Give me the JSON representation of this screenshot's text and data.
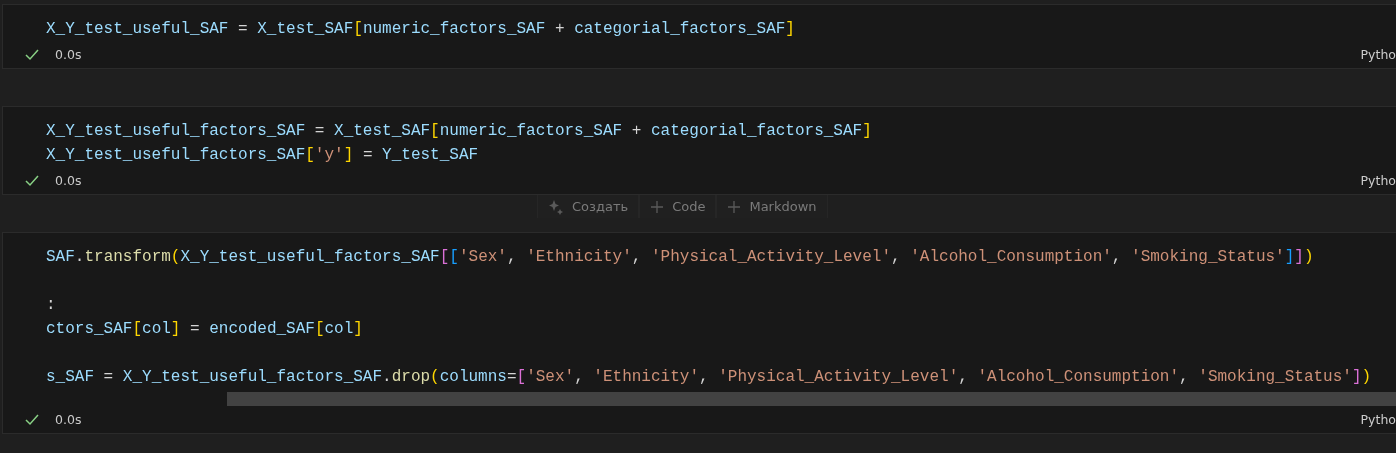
{
  "cells": [
    {
      "lines": [
        {
          "kind": "code",
          "tokens": [
            {
              "kind": "var",
              "text": "X_Y_test_useful_SAF"
            },
            {
              "kind": "op",
              "text": " = "
            },
            {
              "kind": "var",
              "text": "X_test_SAF"
            },
            {
              "kind": "b1",
              "text": "["
            },
            {
              "kind": "var",
              "text": "numeric_factors_SAF"
            },
            {
              "kind": "op",
              "text": " + "
            },
            {
              "kind": "var",
              "text": "categorial_factors_SAF"
            },
            {
              "kind": "b1",
              "text": "]"
            }
          ]
        }
      ],
      "status": {
        "succeeded": true,
        "time": "0.0s",
        "language": "Pytho"
      }
    },
    {
      "lines": [
        {
          "kind": "code",
          "tokens": [
            {
              "kind": "var",
              "text": "X_Y_test_useful_factors_SAF"
            },
            {
              "kind": "op",
              "text": " = "
            },
            {
              "kind": "var",
              "text": "X_test_SAF"
            },
            {
              "kind": "b1",
              "text": "["
            },
            {
              "kind": "var",
              "text": "numeric_factors_SAF"
            },
            {
              "kind": "op",
              "text": " + "
            },
            {
              "kind": "var",
              "text": "categorial_factors_SAF"
            },
            {
              "kind": "b1",
              "text": "]"
            }
          ]
        },
        {
          "kind": "code",
          "tokens": [
            {
              "kind": "var",
              "text": "X_Y_test_useful_factors_SAF"
            },
            {
              "kind": "b1",
              "text": "["
            },
            {
              "kind": "str",
              "text": "'y'"
            },
            {
              "kind": "b1",
              "text": "]"
            },
            {
              "kind": "op",
              "text": " = "
            },
            {
              "kind": "var",
              "text": "Y_test_SAF"
            }
          ]
        }
      ],
      "status": {
        "succeeded": true,
        "time": "0.0s",
        "language": "Pytho"
      },
      "insert_toolbar": [
        {
          "kind": "generate",
          "label": "Создать"
        },
        {
          "kind": "add",
          "label": "Code"
        },
        {
          "kind": "add",
          "label": "Markdown"
        }
      ]
    },
    {
      "lines": [
        {
          "kind": "code",
          "tokens": [
            {
              "kind": "var",
              "text": "SAF"
            },
            {
              "kind": "op",
              "text": "."
            },
            {
              "kind": "fn",
              "text": "transform"
            },
            {
              "kind": "b1",
              "text": "("
            },
            {
              "kind": "var",
              "text": "X_Y_test_useful_factors_SAF"
            },
            {
              "kind": "b2",
              "text": "["
            },
            {
              "kind": "b3",
              "text": "["
            },
            {
              "kind": "str",
              "text": "'Sex'"
            },
            {
              "kind": "op",
              "text": ", "
            },
            {
              "kind": "str",
              "text": "'Ethnicity'"
            },
            {
              "kind": "op",
              "text": ", "
            },
            {
              "kind": "str",
              "text": "'Physical_Activity_Level'"
            },
            {
              "kind": "op",
              "text": ", "
            },
            {
              "kind": "str",
              "text": "'Alcohol_Consumption'"
            },
            {
              "kind": "op",
              "text": ", "
            },
            {
              "kind": "str",
              "text": "'Smoking_Status'"
            },
            {
              "kind": "b3",
              "text": "]"
            },
            {
              "kind": "b2",
              "text": "]"
            },
            {
              "kind": "b1",
              "text": ")"
            }
          ]
        },
        {
          "kind": "blank"
        },
        {
          "kind": "code",
          "tokens": [
            {
              "kind": "op",
              "text": ":"
            }
          ]
        },
        {
          "kind": "code",
          "tokens": [
            {
              "kind": "var",
              "text": "ctors_SAF"
            },
            {
              "kind": "b1",
              "text": "["
            },
            {
              "kind": "var",
              "text": "col"
            },
            {
              "kind": "b1",
              "text": "]"
            },
            {
              "kind": "op",
              "text": " = "
            },
            {
              "kind": "var",
              "text": "encoded_SAF"
            },
            {
              "kind": "b1",
              "text": "["
            },
            {
              "kind": "var",
              "text": "col"
            },
            {
              "kind": "b1",
              "text": "]"
            }
          ]
        },
        {
          "kind": "blank"
        },
        {
          "kind": "code",
          "tokens": [
            {
              "kind": "var",
              "text": "s_SAF"
            },
            {
              "kind": "op",
              "text": " = "
            },
            {
              "kind": "var",
              "text": "X_Y_test_useful_factors_SAF"
            },
            {
              "kind": "op",
              "text": "."
            },
            {
              "kind": "fn",
              "text": "drop"
            },
            {
              "kind": "b1",
              "text": "("
            },
            {
              "kind": "var",
              "text": "columns"
            },
            {
              "kind": "op",
              "text": "="
            },
            {
              "kind": "b2",
              "text": "["
            },
            {
              "kind": "str",
              "text": "'Sex'"
            },
            {
              "kind": "op",
              "text": ", "
            },
            {
              "kind": "str",
              "text": "'Ethnicity'"
            },
            {
              "kind": "op",
              "text": ", "
            },
            {
              "kind": "str",
              "text": "'Physical_Activity_Level'"
            },
            {
              "kind": "op",
              "text": ", "
            },
            {
              "kind": "str",
              "text": "'Alcohol_Consumption'"
            },
            {
              "kind": "op",
              "text": ", "
            },
            {
              "kind": "str",
              "text": "'Smoking_Status'"
            },
            {
              "kind": "b2",
              "text": "]"
            },
            {
              "kind": "b1",
              "text": ")"
            }
          ]
        }
      ],
      "horizontal_scrollbar": true,
      "status": {
        "succeeded": true,
        "time": "0.0s",
        "language": "Pytho"
      }
    }
  ]
}
